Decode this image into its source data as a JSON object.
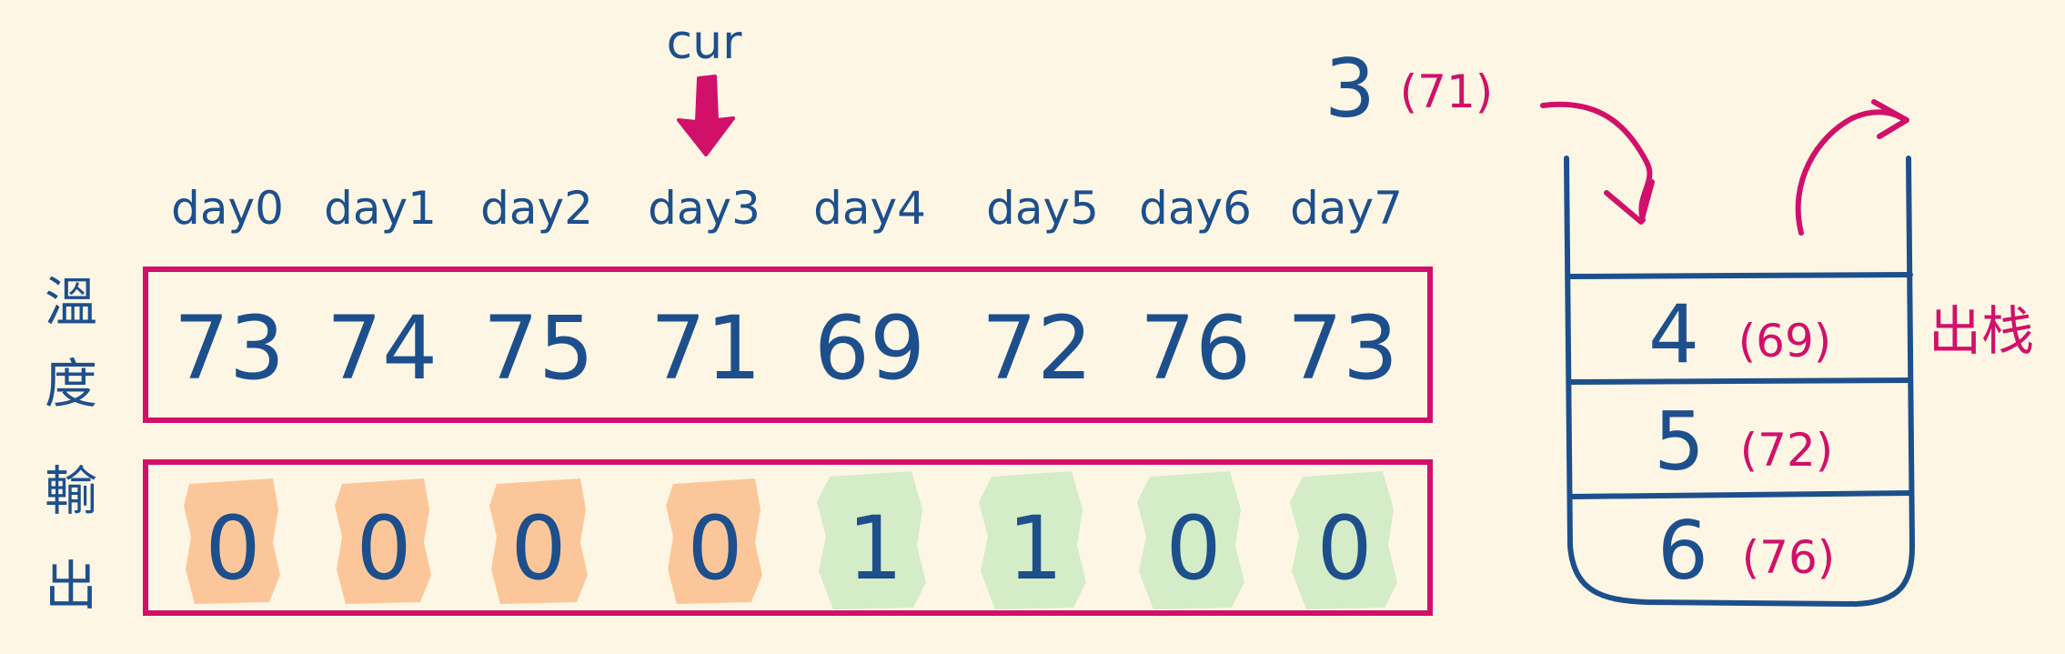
{
  "pointer": {
    "label": "cur"
  },
  "days": [
    "day0",
    "day1",
    "day2",
    "day3",
    "day4",
    "day5",
    "day6",
    "day7"
  ],
  "rows": {
    "temperature": {
      "label_chars": [
        "溫",
        "度"
      ],
      "values": [
        "73",
        "74",
        "75",
        "71",
        "69",
        "72",
        "76",
        "73"
      ]
    },
    "output": {
      "label_chars": [
        "輸",
        "出"
      ],
      "values": [
        "0",
        "0",
        "0",
        "0",
        "1",
        "1",
        "0",
        "0"
      ],
      "highlight": [
        "orange",
        "orange",
        "orange",
        "orange",
        "green",
        "green",
        "green",
        "green"
      ]
    }
  },
  "stack": {
    "incoming": {
      "index": "3",
      "temp": "(71)"
    },
    "pop_label": "出栈",
    "items": [
      {
        "index": "4",
        "temp": "(69)"
      },
      {
        "index": "5",
        "temp": "(72)"
      },
      {
        "index": "6",
        "temp": "(76)"
      }
    ]
  },
  "colors": {
    "background": "#fdf6e4",
    "ink_blue": "#1d4f8c",
    "ink_red": "#d1106a",
    "highlight_orange": "#fbc79a",
    "highlight_green": "#d4ecc7"
  }
}
